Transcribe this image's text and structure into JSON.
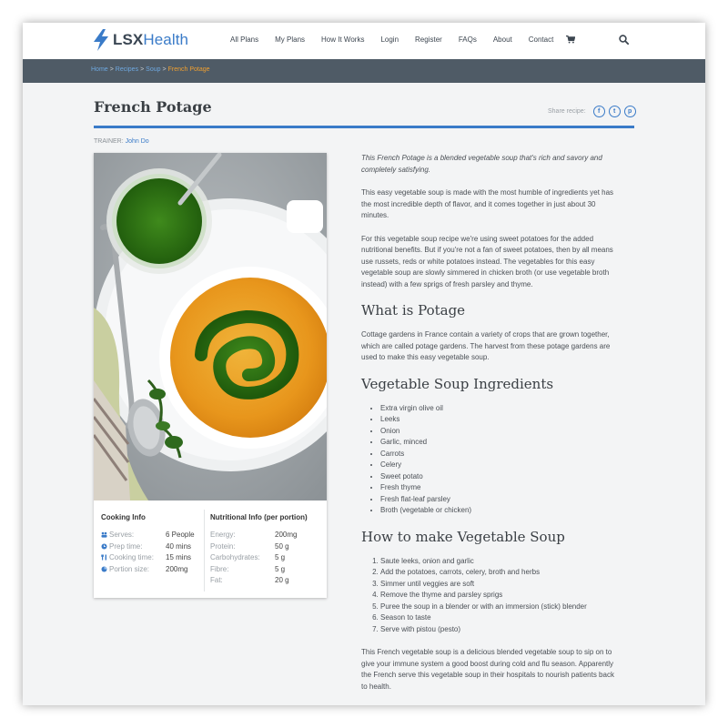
{
  "header": {
    "logo_lsx": "LSX",
    "logo_health": "Health",
    "nav": [
      "All Plans",
      "My Plans",
      "How It Works",
      "Login",
      "Register",
      "FAQs",
      "About",
      "Contact"
    ],
    "cart_icon": "cart-icon",
    "search_icon": "search-icon"
  },
  "breadcrumb": {
    "items": [
      "Home",
      "Recipes",
      "Soup"
    ],
    "separator": ">",
    "current": "French Potage"
  },
  "page": {
    "title": "French Potage",
    "share_label": "Share recipe:",
    "share_buttons": [
      "f",
      "t",
      "p"
    ],
    "trainer_label": "TRAINER:",
    "trainer_name": "John Do"
  },
  "cooking_info": {
    "heading": "Cooking Info",
    "rows": [
      {
        "icon": "people-icon",
        "label": "Serves:",
        "value": "6 People"
      },
      {
        "icon": "clock-icon",
        "label": "Prep time:",
        "value": "40 mins"
      },
      {
        "icon": "utensils-icon",
        "label": "Cooking time:",
        "value": "15 mins"
      },
      {
        "icon": "pie-icon",
        "label": "Portion size:",
        "value": "200mg"
      }
    ]
  },
  "nutrition_info": {
    "heading": "Nutritional Info (per portion)",
    "rows": [
      {
        "label": "Energy:",
        "value": "200mg"
      },
      {
        "label": "Protein:",
        "value": "50 g"
      },
      {
        "label": "Carbohydrates:",
        "value": "5 g"
      },
      {
        "label": "Fibre:",
        "value": "5 g"
      },
      {
        "label": "Fat:",
        "value": "20 g"
      }
    ]
  },
  "content": {
    "intro": "This French Potage is a blended vegetable soup that's rich and savory and completely satisfying.",
    "para1": "This easy vegetable soup is made with the most humble of ingredients yet has the most incredible depth of flavor, and it comes together in just about 30 minutes.",
    "para2": "For this vegetable soup recipe we're using sweet potatoes for the added nutritional benefits.  But if you're not a fan of sweet potatoes, then by all means use russets, reds or white potatoes instead.  The vegetables for this easy vegetable soup are slowly simmered in chicken broth (or use vegetable broth instead) with a few sprigs of fresh parsley and thyme.",
    "h_potage": "What is Potage",
    "para3": "Cottage  gardens in France contain a variety of crops that are grown together, which are called potage gardens.  The harvest from these potage gardens are used to make this easy vegetable soup.",
    "h_ingredients": "Vegetable Soup Ingredients",
    "ingredients": [
      "Extra virgin olive oil",
      "Leeks",
      "Onion",
      "Garlic, minced",
      "Carrots",
      "Celery",
      "Sweet potato",
      "Fresh thyme",
      "Fresh flat-leaf parsley",
      "Broth (vegetable or chicken)"
    ],
    "h_method": "How to make Vegetable Soup",
    "steps": [
      "Saute leeks, onion and garlic",
      "Add the potatoes, carrots, celery, broth and herbs",
      "Simmer until veggies are soft",
      "Remove the thyme and parsley sprigs",
      "Puree the soup in a blender or with an immersion (stick) blender",
      "Season to taste",
      "Serve with pistou (pesto)"
    ],
    "para4": "This French vegetable soup is a delicious blended vegetable soup to sip on to give your immune system a good boost during cold and flu season. Apparently the French serve this vegetable soup in their hospitals to nourish patients back to health."
  },
  "colors": {
    "accent": "#3a7bc8",
    "crumbbar": "#4f5b66",
    "breadcrumb_current": "#f0a030"
  }
}
